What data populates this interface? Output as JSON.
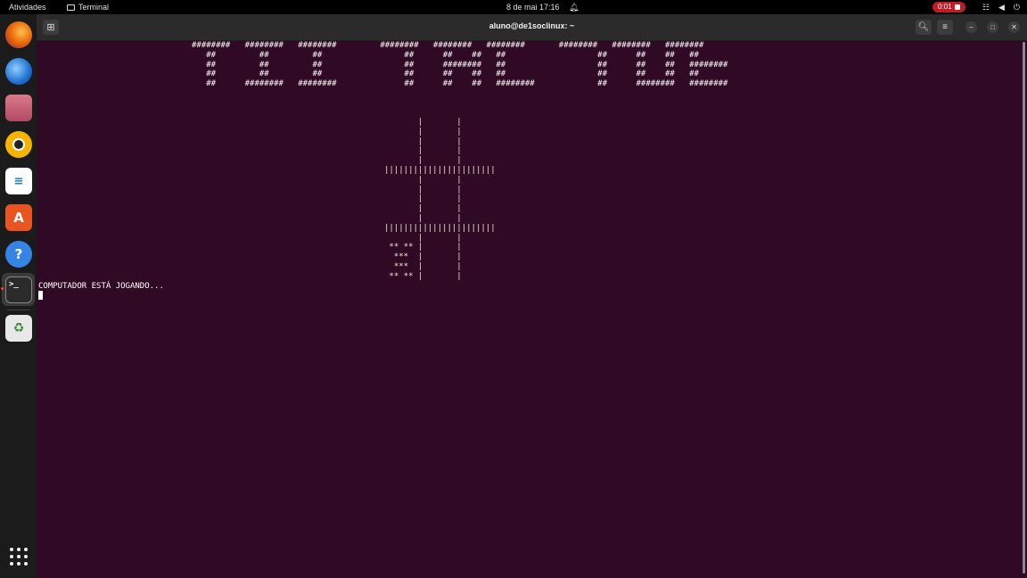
{
  "topbar": {
    "activities": "Atividades",
    "app_name": "Terminal",
    "clock": "8 de mai  17:16",
    "recording_time": "0:01",
    "tray_icons": [
      "network-icon",
      "volume-icon",
      "power-icon"
    ]
  },
  "dock": {
    "apps": [
      {
        "name": "firefox-icon",
        "color": "#e66000"
      },
      {
        "name": "thunderbird-icon",
        "color": "#1f6fd1"
      },
      {
        "name": "files-icon",
        "color": "#c86478"
      },
      {
        "name": "rhythmbox-icon",
        "color": "#f4b400"
      },
      {
        "name": "libreoffice-writer-icon",
        "color": "#1e7be0"
      },
      {
        "name": "app-center-icon",
        "color": "#e95420"
      },
      {
        "name": "help-icon",
        "color": "#3584e4"
      },
      {
        "name": "terminal-icon",
        "color": "#2b2b2b"
      },
      {
        "name": "trash-icon",
        "color": "#e8e8e8"
      }
    ],
    "show_apps": "show-apps-grid-icon"
  },
  "window": {
    "title": "aluno@de1soclinux: ~"
  },
  "terminal": {
    "banner": "########   ########   ########         ########   ########   ########       ########   ########   ########\n   ##         ##         ##                 ##      ##    ##   ##                   ##      ##    ##   ##\n   ##         ##         ##                 ##      ########   ##                   ##      ##    ##   ########\n   ##         ##         ##                 ##      ##    ##   ##                   ##      ##    ##   ##\n   ##      ########   ########              ##      ##    ##   ########             ##      ########   ########",
    "board": "       |       |\n       |       |\n       |       |\n       |       |\n       |       |\n|||||||||||||||||||||||\n       |       |\n       |       |\n       |       |\n       |       |\n       |       |\n|||||||||||||||||||||||\n       |       |\n ** ** |       |\n  ***  |       |\n  ***  |       |\n ** ** |       |",
    "status": "COMPUTADOR ESTÁ JOGANDO..."
  },
  "colors": {
    "terminal_bg": "#300a24",
    "recording": "#c01c28",
    "board_text": "#f2e6cf"
  }
}
